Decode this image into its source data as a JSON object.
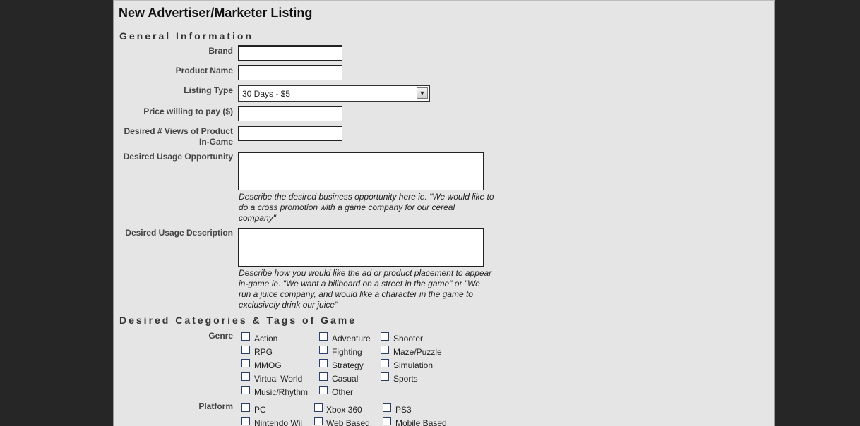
{
  "page_title": "New Advertiser/Marketer Listing",
  "sections": {
    "general": "General Information",
    "categories": "Desired Categories & Tags of Game"
  },
  "fields": {
    "brand": {
      "label": "Brand",
      "value": ""
    },
    "product_name": {
      "label": "Product Name",
      "value": ""
    },
    "listing_type": {
      "label": "Listing Type",
      "value": "30 Days - $5"
    },
    "price": {
      "label": "Price willing to pay ($)",
      "value": ""
    },
    "views": {
      "label_line1": "Desired # Views of Product",
      "label_line2": "In-Game",
      "value": ""
    },
    "usage_opportunity": {
      "label": "Desired Usage Opportunity",
      "value": "",
      "help": "Describe the desired business opportunity here ie. \"We would like to do a cross promotion with a game company for our cereal company\""
    },
    "usage_description": {
      "label": "Desired Usage Description",
      "value": "",
      "help": "Describe how you would like the ad or product placement to appear in-game ie. \"We want a billboard on a street in the game\" or \"We run a juice company, and would like a character in the game to exclusively drink our juice\""
    }
  },
  "genre": {
    "label": "Genre",
    "options": [
      "Action",
      "Adventure",
      "Shooter",
      "RPG",
      "Fighting",
      "Maze/Puzzle",
      "MMOG",
      "Strategy",
      "Simulation",
      "Virtual World",
      "Casual",
      "Sports",
      "Music/Rhythm",
      "Other"
    ]
  },
  "platform": {
    "label": "Platform",
    "options": [
      "PC",
      "Xbox 360",
      "PS3",
      "Nintendo Wii",
      "Web Based",
      "Mobile Based"
    ]
  }
}
